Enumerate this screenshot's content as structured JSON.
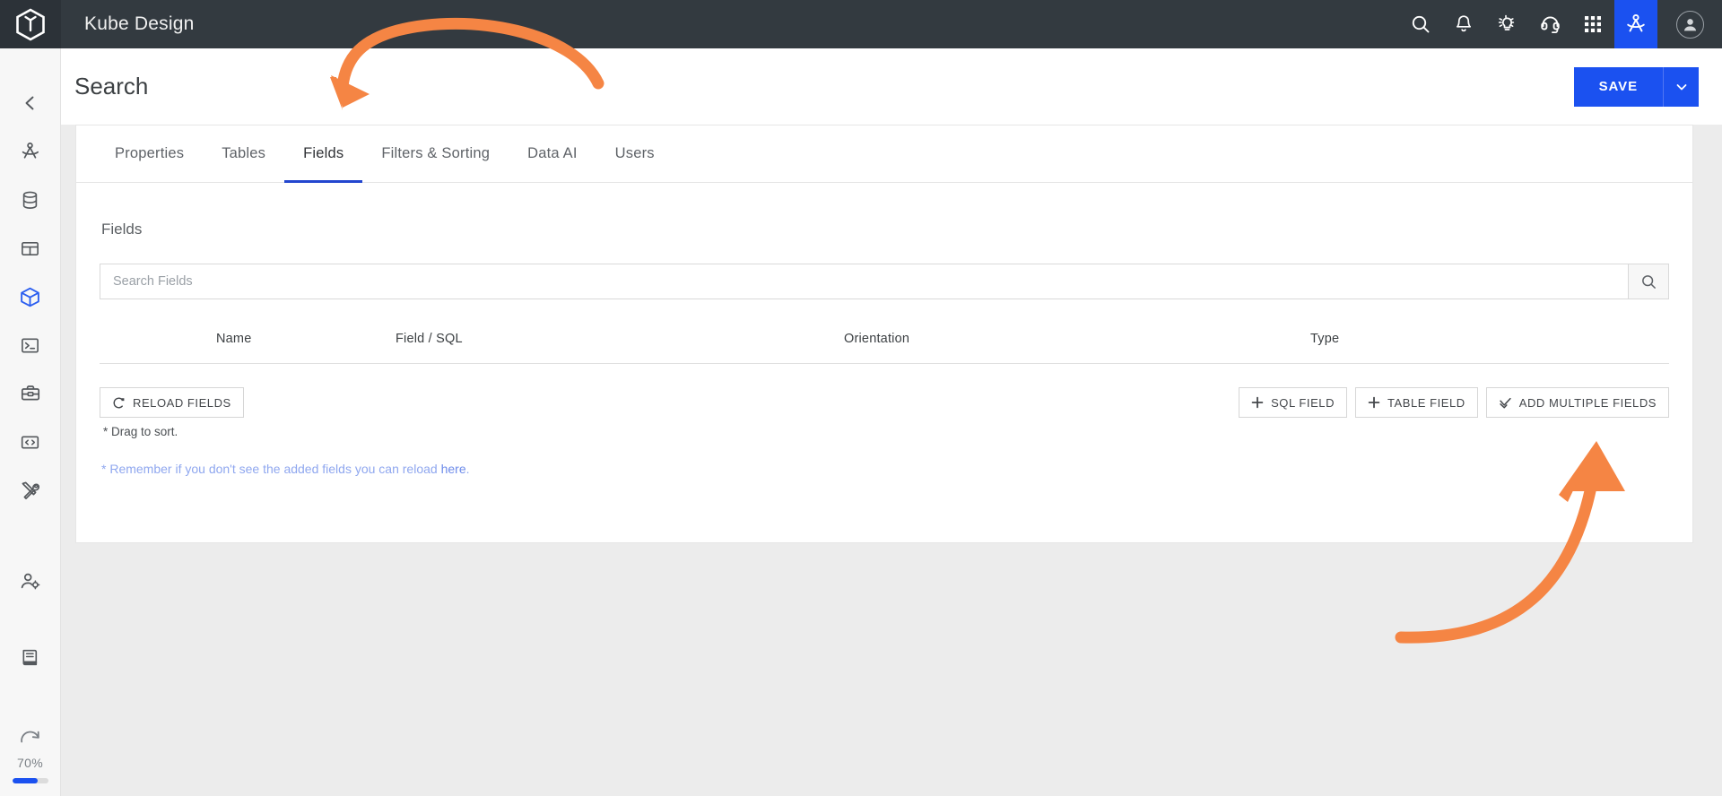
{
  "topbar": {
    "app_title": "Kube Design",
    "logo_icon": "cube-logo-icon",
    "icons": [
      {
        "name": "search-icon",
        "label": "Search"
      },
      {
        "name": "bell-icon",
        "label": "Notifications"
      },
      {
        "name": "lightbulb-icon",
        "label": "Ideas"
      },
      {
        "name": "headset-icon",
        "label": "Support"
      },
      {
        "name": "grid-apps-icon",
        "label": "Apps"
      },
      {
        "name": "designer-icon",
        "label": "Designer"
      }
    ],
    "avatar_icon": "user-avatar-icon"
  },
  "rail": {
    "items": [
      {
        "name": "collapse-icon",
        "label": "Collapse"
      },
      {
        "name": "designer-icon",
        "label": "Designer"
      },
      {
        "name": "database-icon",
        "label": "Data Sources"
      },
      {
        "name": "table-icon",
        "label": "Tables"
      },
      {
        "name": "cube-icon",
        "label": "Cubes",
        "active": true
      },
      {
        "name": "terminal-icon",
        "label": "Console"
      },
      {
        "name": "toolbox-icon",
        "label": "Toolbox"
      },
      {
        "name": "code-icon",
        "label": "Code"
      },
      {
        "name": "tools-icon",
        "label": "Tools"
      },
      {
        "name": "user-settings-icon",
        "label": "User Settings"
      },
      {
        "name": "book-icon",
        "label": "Documentation"
      },
      {
        "name": "refresh-icon",
        "label": "Refresh"
      }
    ],
    "progress_label": "70%",
    "progress_value": 70
  },
  "page": {
    "title": "Search",
    "save_label": "SAVE",
    "save_caret_icon": "chevron-down-icon"
  },
  "tabs": [
    {
      "label": "Properties",
      "active": false
    },
    {
      "label": "Tables",
      "active": false
    },
    {
      "label": "Fields",
      "active": true
    },
    {
      "label": "Filters & Sorting",
      "active": false
    },
    {
      "label": "Data AI",
      "active": false
    },
    {
      "label": "Users",
      "active": false
    }
  ],
  "fields_section": {
    "title": "Fields",
    "search_placeholder": "Search Fields",
    "search_value": "",
    "search_button_icon": "search-icon",
    "columns": [
      "Name",
      "Field / SQL",
      "Orientation",
      "Type"
    ],
    "rows": [],
    "reload_button": "RELOAD FIELDS",
    "reload_icon": "refresh-icon",
    "drag_note": "* Drag to sort.",
    "sql_field_button": "SQL FIELD",
    "table_field_button": "TABLE FIELD",
    "add_multiple_button": "ADD MULTIPLE FIELDS",
    "plus_icon": "plus-icon",
    "check_icon": "check-icon",
    "footer_note_prefix": "* Remember if you don't see the added fields you can reload ",
    "footer_note_link": "here",
    "footer_note_suffix": "."
  },
  "annotations": {
    "color": "#f58544",
    "arrow_1_target": "Fields tab",
    "arrow_2_target": "ADD MULTIPLE FIELDS button"
  },
  "colors": {
    "accent": "#1b51f0",
    "topbar": "#333a40",
    "annotation": "#f58544"
  }
}
